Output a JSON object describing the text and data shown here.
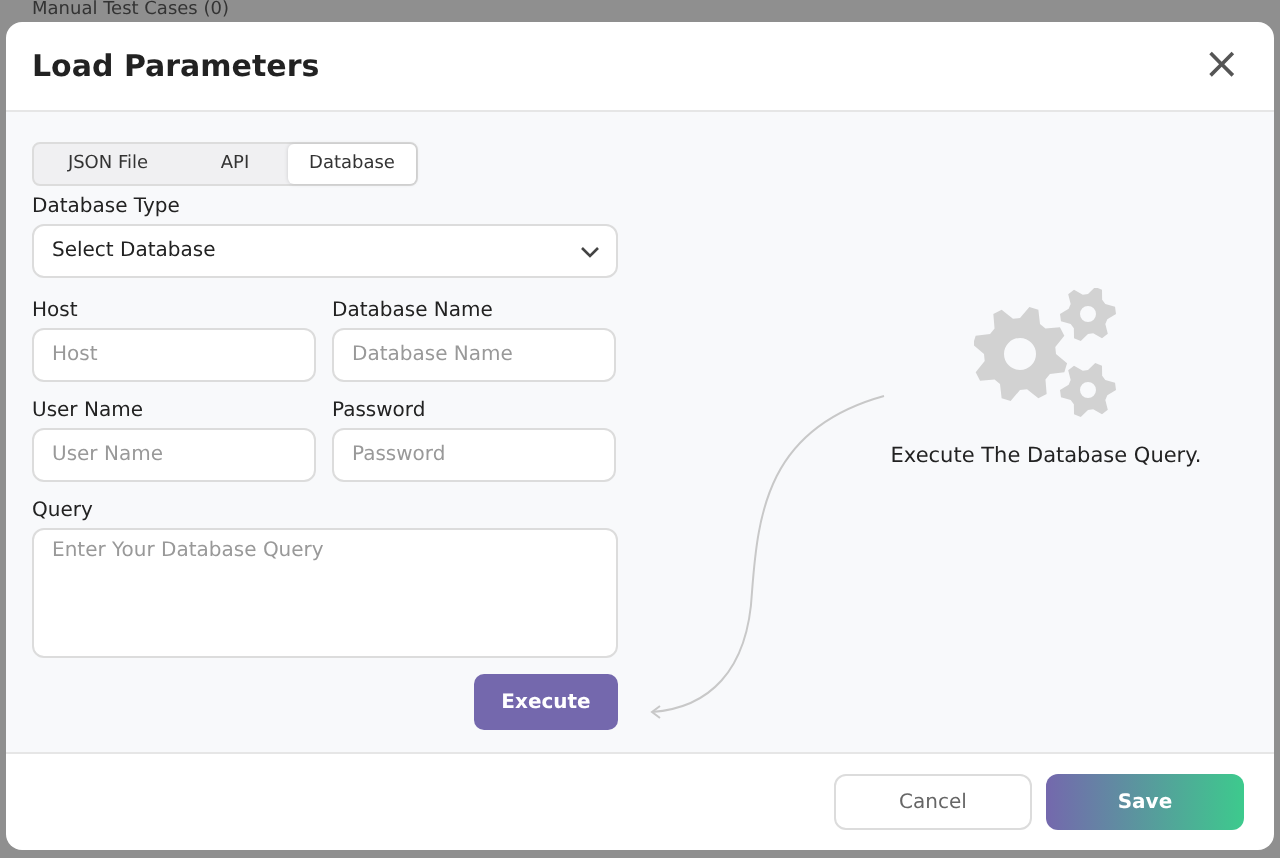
{
  "background": {
    "title": "Manual Test Cases (0)"
  },
  "dialog": {
    "title": "Load Parameters",
    "close": "×"
  },
  "tabs": [
    {
      "label": "JSON File",
      "selected": false
    },
    {
      "label": "API",
      "selected": false
    },
    {
      "label": "Database",
      "selected": true
    }
  ],
  "database_type": {
    "label": "Database Type",
    "value": "Select Database"
  },
  "fields": [
    {
      "label": "Host",
      "placeholder": "Host"
    },
    {
      "label": "Database Name",
      "placeholder": "Database Name"
    },
    {
      "label": "User Name",
      "placeholder": "User Name"
    },
    {
      "label": "Password",
      "placeholder": "Password"
    }
  ],
  "query": {
    "label": "Query",
    "placeholder": "Enter Your Database Query"
  },
  "execute_button": "Execute",
  "hint": "Execute The Database Query.",
  "footer_buttons": [
    {
      "label": "Cancel",
      "kind": "secondary"
    },
    {
      "label": "Save",
      "kind": "primary"
    }
  ]
}
